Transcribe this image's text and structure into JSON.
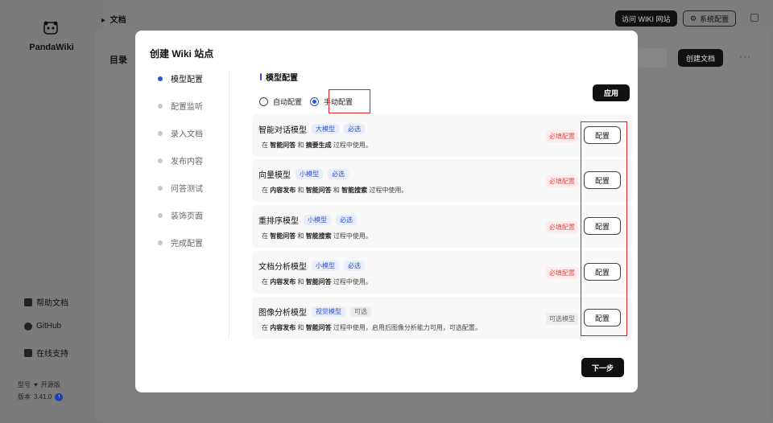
{
  "app": {
    "brand": "PandaWiki",
    "breadcrumb": "文档",
    "top_buttons": {
      "visit_wiki": "访问 WIKI 网站",
      "system_config": "系统配置"
    },
    "toc_label": "目录",
    "create_doc": "创建文档",
    "more": "···",
    "sidebar_links": [
      "帮助文档",
      "GitHub",
      "在线支持"
    ],
    "edition_label": "型号",
    "edition_value": "开源版",
    "version_label": "版本",
    "version_value": "3.41.0"
  },
  "modal": {
    "title": "创建 Wiki 站点",
    "steps": [
      "模型配置",
      "配置监听",
      "录入文档",
      "发布内容",
      "问答测试",
      "装饰页面",
      "完成配置"
    ],
    "active_step": 0,
    "section_title": "模型配置",
    "radio_auto": "自动配置",
    "radio_manual": "手动配置",
    "selected_mode": "manual",
    "apply": "应用",
    "next": "下一步",
    "config_button": "配置",
    "models": [
      {
        "name": "智能对话模型",
        "size_tag": "大模型",
        "req_tag": "必选",
        "status": "必填配置",
        "desc_parts": [
          "在 ",
          "智能问答",
          " 和 ",
          "摘要生成",
          " 过程中使用。"
        ]
      },
      {
        "name": "向量模型",
        "size_tag": "小模型",
        "req_tag": "必选",
        "status": "必填配置",
        "desc_parts": [
          "在 ",
          "内容发布",
          " 和 ",
          "智能问答",
          " 和 ",
          "智能搜索",
          " 过程中使用。"
        ]
      },
      {
        "name": "重排序模型",
        "size_tag": "小模型",
        "req_tag": "必选",
        "status": "必填配置",
        "desc_parts": [
          "在 ",
          "智能问答",
          " 和 ",
          "智能搜索",
          " 过程中使用。"
        ]
      },
      {
        "name": "文档分析模型",
        "size_tag": "小模型",
        "req_tag": "必选",
        "status": "必填配置",
        "desc_parts": [
          "在 ",
          "内容发布",
          " 和 ",
          "智能问答",
          " 过程中使用。"
        ]
      },
      {
        "name": "图像分析模型",
        "size_tag": "视觉模型",
        "req_tag": "可选",
        "status": "可选模型",
        "desc_parts": [
          "在 ",
          "内容发布",
          " 和 ",
          "智能问答",
          " 过程中使用，启用后图像分析能力可用，可选配置。"
        ]
      }
    ]
  }
}
